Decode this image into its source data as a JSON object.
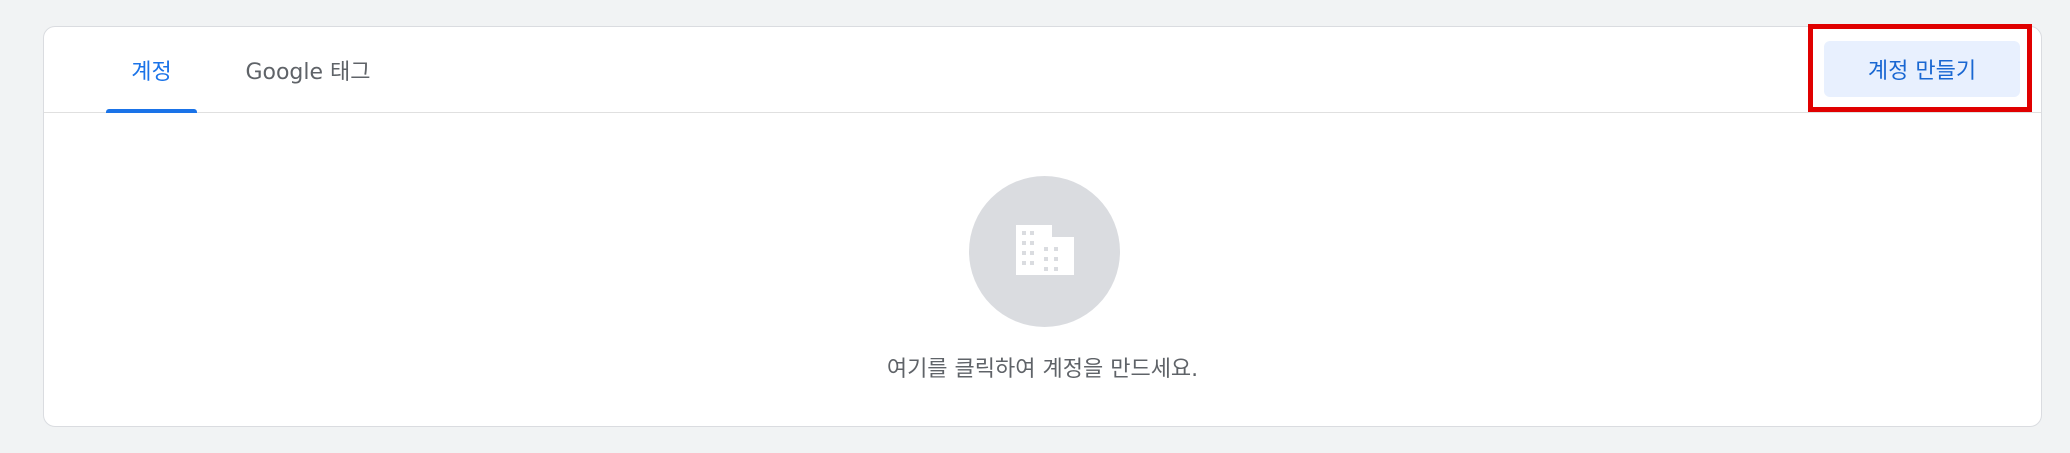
{
  "tabs": {
    "accounts_label": "계정",
    "google_tag_label": "Google 태그",
    "active": "accounts"
  },
  "toolbar": {
    "create_account_label": "계정 만들기"
  },
  "empty_state": {
    "icon": "building-icon",
    "message": "여기를 클릭하여 계정을 만드세요."
  },
  "colors": {
    "accent": "#1a73e8",
    "button_bg": "#e8f0fe",
    "highlight": "#e00000",
    "icon_circle": "#dadce0"
  }
}
